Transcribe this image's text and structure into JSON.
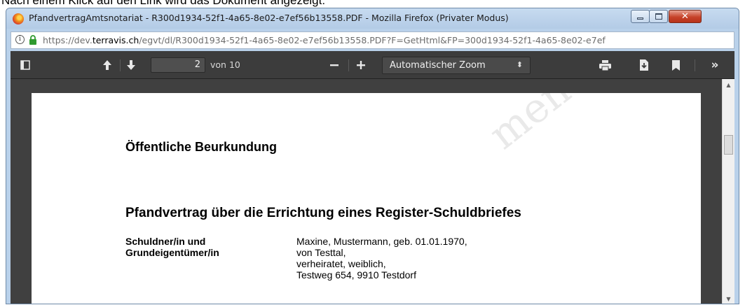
{
  "caption": "Nach einem Klick auf den Link wird das Dokument angezeigt:",
  "window": {
    "title": "PfandvertragAmtsnotariat - R300d1934-52f1-4a65-8e02-e7ef56b13558.PDF - Mozilla Firefox (Privater Modus)",
    "controls": {
      "minimize_icon": "minimize-icon",
      "maximize_icon": "maximize-icon",
      "close_icon": "close-icon"
    }
  },
  "urlbar": {
    "prefix": "https://dev.",
    "domain": "terravis.ch",
    "rest": "/egvt/dl/R300d1934-52f1-4a65-8e02-e7ef56b13558.PDF?F=GetHtml&FP=300d1934-52f1-4a65-8e02-e7ef"
  },
  "toolbar": {
    "page_current": "2",
    "page_of": "von 10",
    "zoom": "Automatischer Zoom",
    "icons": [
      "sidebar-toggle-icon",
      "previous-page-icon",
      "next-page-icon",
      "zoom-out-icon",
      "zoom-in-icon",
      "print-icon",
      "download-icon",
      "bookmark-icon",
      "tools-icon"
    ]
  },
  "document": {
    "watermark": "ment",
    "heading": "Öffentliche Beurkundung",
    "subheading": "Pfandvertrag über die Errichtung eines Register-Schuldbriefes",
    "party_label": [
      "Schuldner/in und",
      "Grundeigentümer/in"
    ],
    "party_details": [
      "Maxine, Mustermann, geb. 01.01.1970,",
      "von Testtal,",
      "verheiratet, weiblich,",
      "Testweg 654, 9910 Testdorf"
    ]
  },
  "colors": {
    "toolbar": "#3c3c3c",
    "viewer": "#404040",
    "titlebar": "#b9d1ea",
    "close": "#c6432a"
  }
}
